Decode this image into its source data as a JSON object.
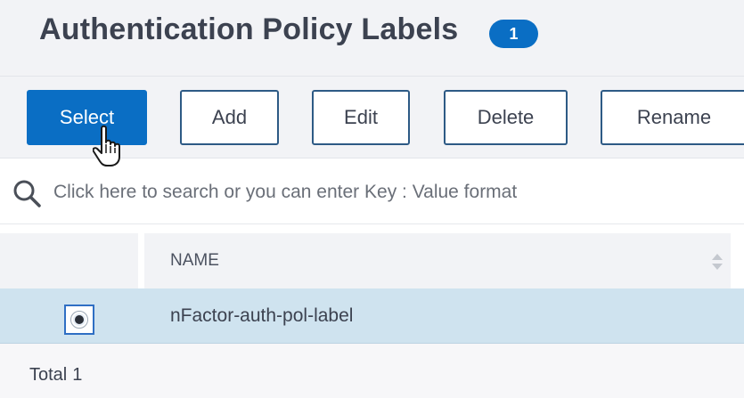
{
  "header": {
    "title": "Authentication Policy Labels",
    "count": "1"
  },
  "toolbar": {
    "select_label": "Select",
    "add_label": "Add",
    "edit_label": "Edit",
    "delete_label": "Delete",
    "rename_label": "Rename"
  },
  "search": {
    "placeholder": "Click here to search or you can enter Key : Value format"
  },
  "table": {
    "columns": [
      "NAME"
    ],
    "rows": [
      {
        "selected": true,
        "name": "nFactor-auth-pol-label"
      }
    ]
  },
  "footer": {
    "total_label": "Total",
    "total_value": "1"
  },
  "colors": {
    "accent": "#0a6ec4",
    "row_selected": "#cfe3ef",
    "panel_bg": "#f2f3f6"
  }
}
